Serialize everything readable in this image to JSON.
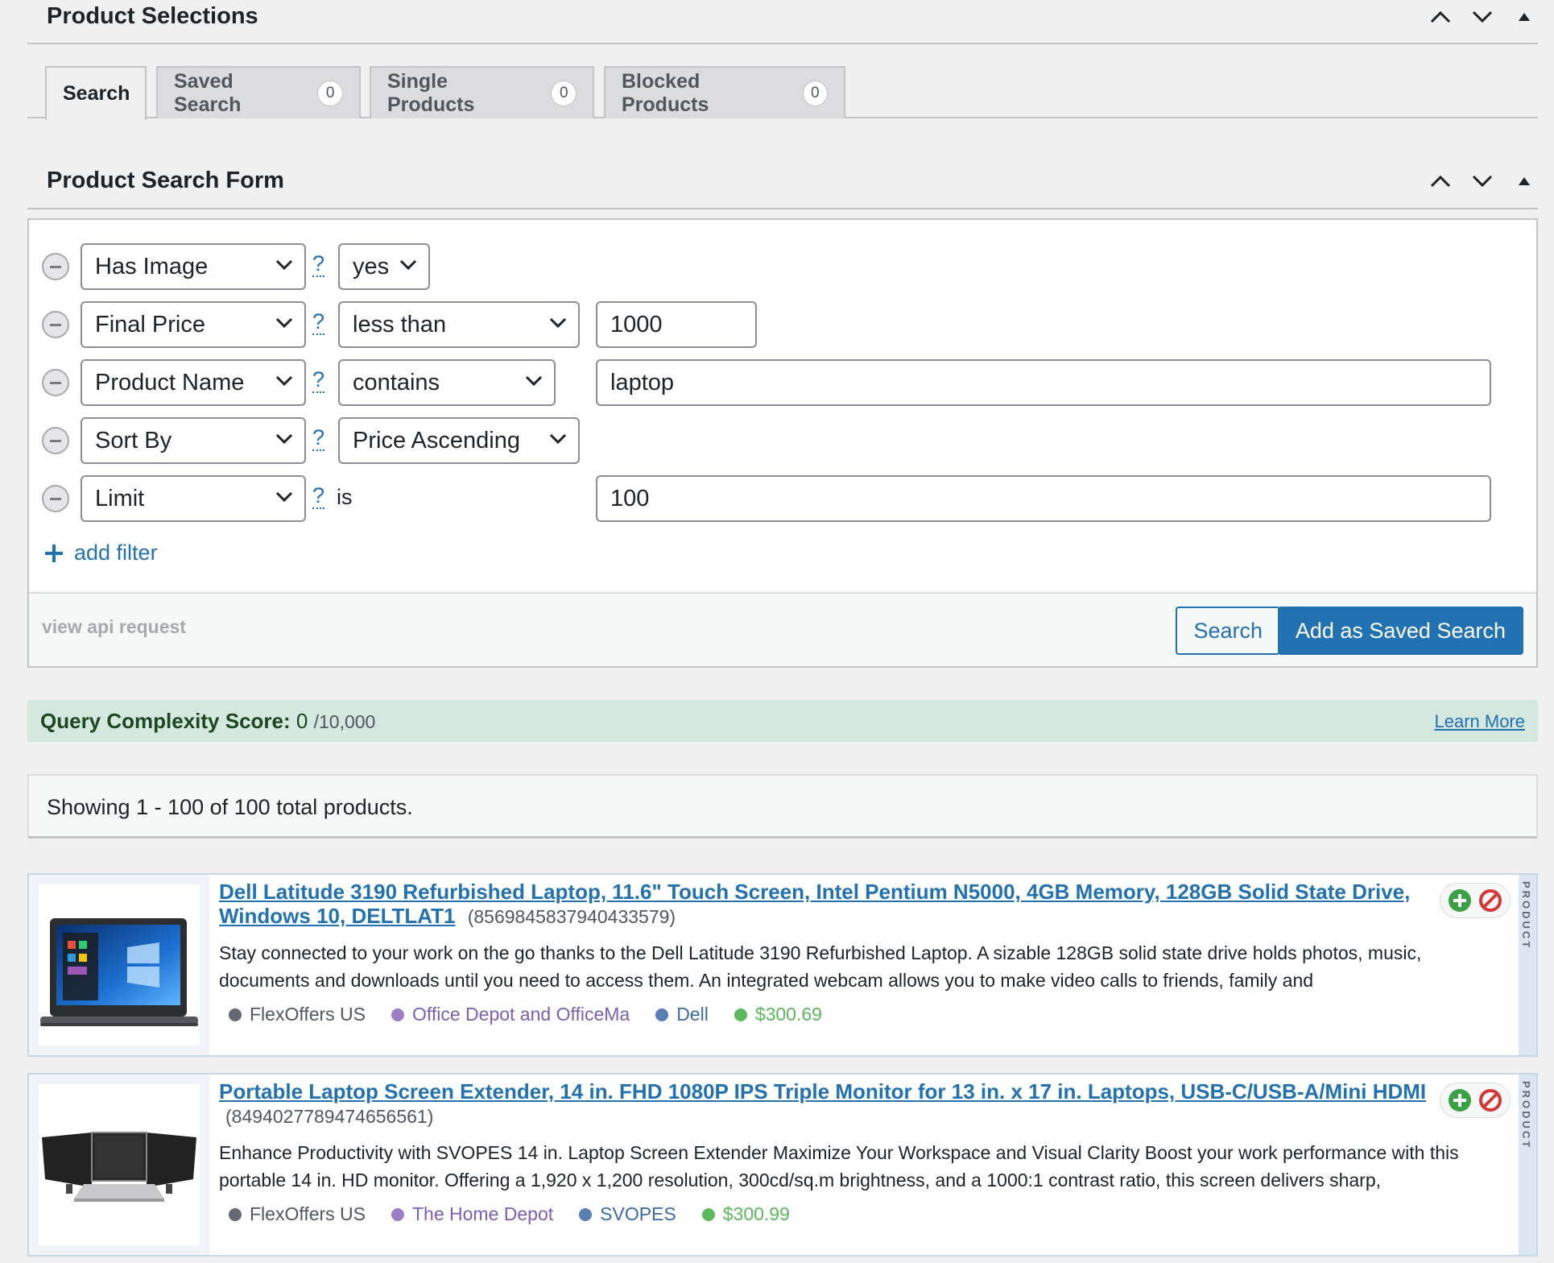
{
  "product_selections": {
    "title": "Product Selections"
  },
  "tabs": [
    {
      "label": "Search",
      "count": null
    },
    {
      "label": "Saved Search",
      "count": "0"
    },
    {
      "label": "Single Products",
      "count": "0"
    },
    {
      "label": "Blocked Products",
      "count": "0"
    }
  ],
  "search_form": {
    "title": "Product Search Form",
    "filters": [
      {
        "field": "Has Image",
        "operator": "yes",
        "value": null
      },
      {
        "field": "Final Price",
        "operator": "less than",
        "value": "1000"
      },
      {
        "field": "Product Name",
        "operator": "contains",
        "value": "laptop"
      },
      {
        "field": "Sort By",
        "operator": "Price Ascending",
        "value": null
      },
      {
        "field": "Limit",
        "operator": "is",
        "value": "100"
      }
    ],
    "help_glyph": "?",
    "add_filter_label": "add filter",
    "view_api_label": "view api request",
    "search_button": "Search",
    "save_button": "Add as Saved Search"
  },
  "query_complexity": {
    "label": "Query Complexity Score:",
    "score": "0",
    "max": "/10,000",
    "learn_more": "Learn More"
  },
  "results": {
    "showing_text": "Showing 1 - 100 of 100 total products."
  },
  "products": [
    {
      "title": "Dell Latitude 3190 Refurbished Laptop, 11.6\" Touch Screen, Intel Pentium N5000, 4GB Memory, 128GB Solid State Drive, Windows 10, DELTLAT1",
      "id": "(8569845837940433579)",
      "description": "Stay connected to your work on the go thanks to the Dell Latitude 3190 Refurbished Laptop. A sizable 128GB solid state drive holds photos, music, documents and downloads until you need to access them. An integrated webcam allows you to make video calls to friends, family and",
      "network": "FlexOffers US",
      "merchant": "Office Depot and OfficeMa",
      "brand": "Dell",
      "price": "$300.69",
      "side_label": "PRODUCT",
      "image_icon": "laptop-image"
    },
    {
      "title": "Portable Laptop Screen Extender, 14 in. FHD 1080P IPS Triple Monitor for 13 in. x 17 in. Laptops, USB-C/USB-A/Mini HDMI",
      "id": "(8494027789474656561)",
      "description": "Enhance Productivity with SVOPES 14 in. Laptop Screen Extender Maximize Your Workspace and Visual Clarity Boost your work performance with this portable 14 in. HD monitor. Offering a 1,920 x 1,200 resolution, 300cd/sq.m brightness, and a 1000:1 contrast ratio, this screen delivers sharp,",
      "network": "FlexOffers US",
      "merchant": "The Home Depot",
      "brand": "SVOPES",
      "price": "$300.99",
      "side_label": "PRODUCT",
      "image_icon": "triple-monitor-image"
    }
  ],
  "colors": {
    "accent": "#2271b1",
    "network_dot": "#646970",
    "merchant_dot": "#9b7fc2",
    "merchant_text": "#7b5fb0",
    "brand_dot": "#5b7fb5",
    "brand_text": "#3d6aa8",
    "price": "#5cb85c",
    "qc_background": "#d5e8df"
  }
}
